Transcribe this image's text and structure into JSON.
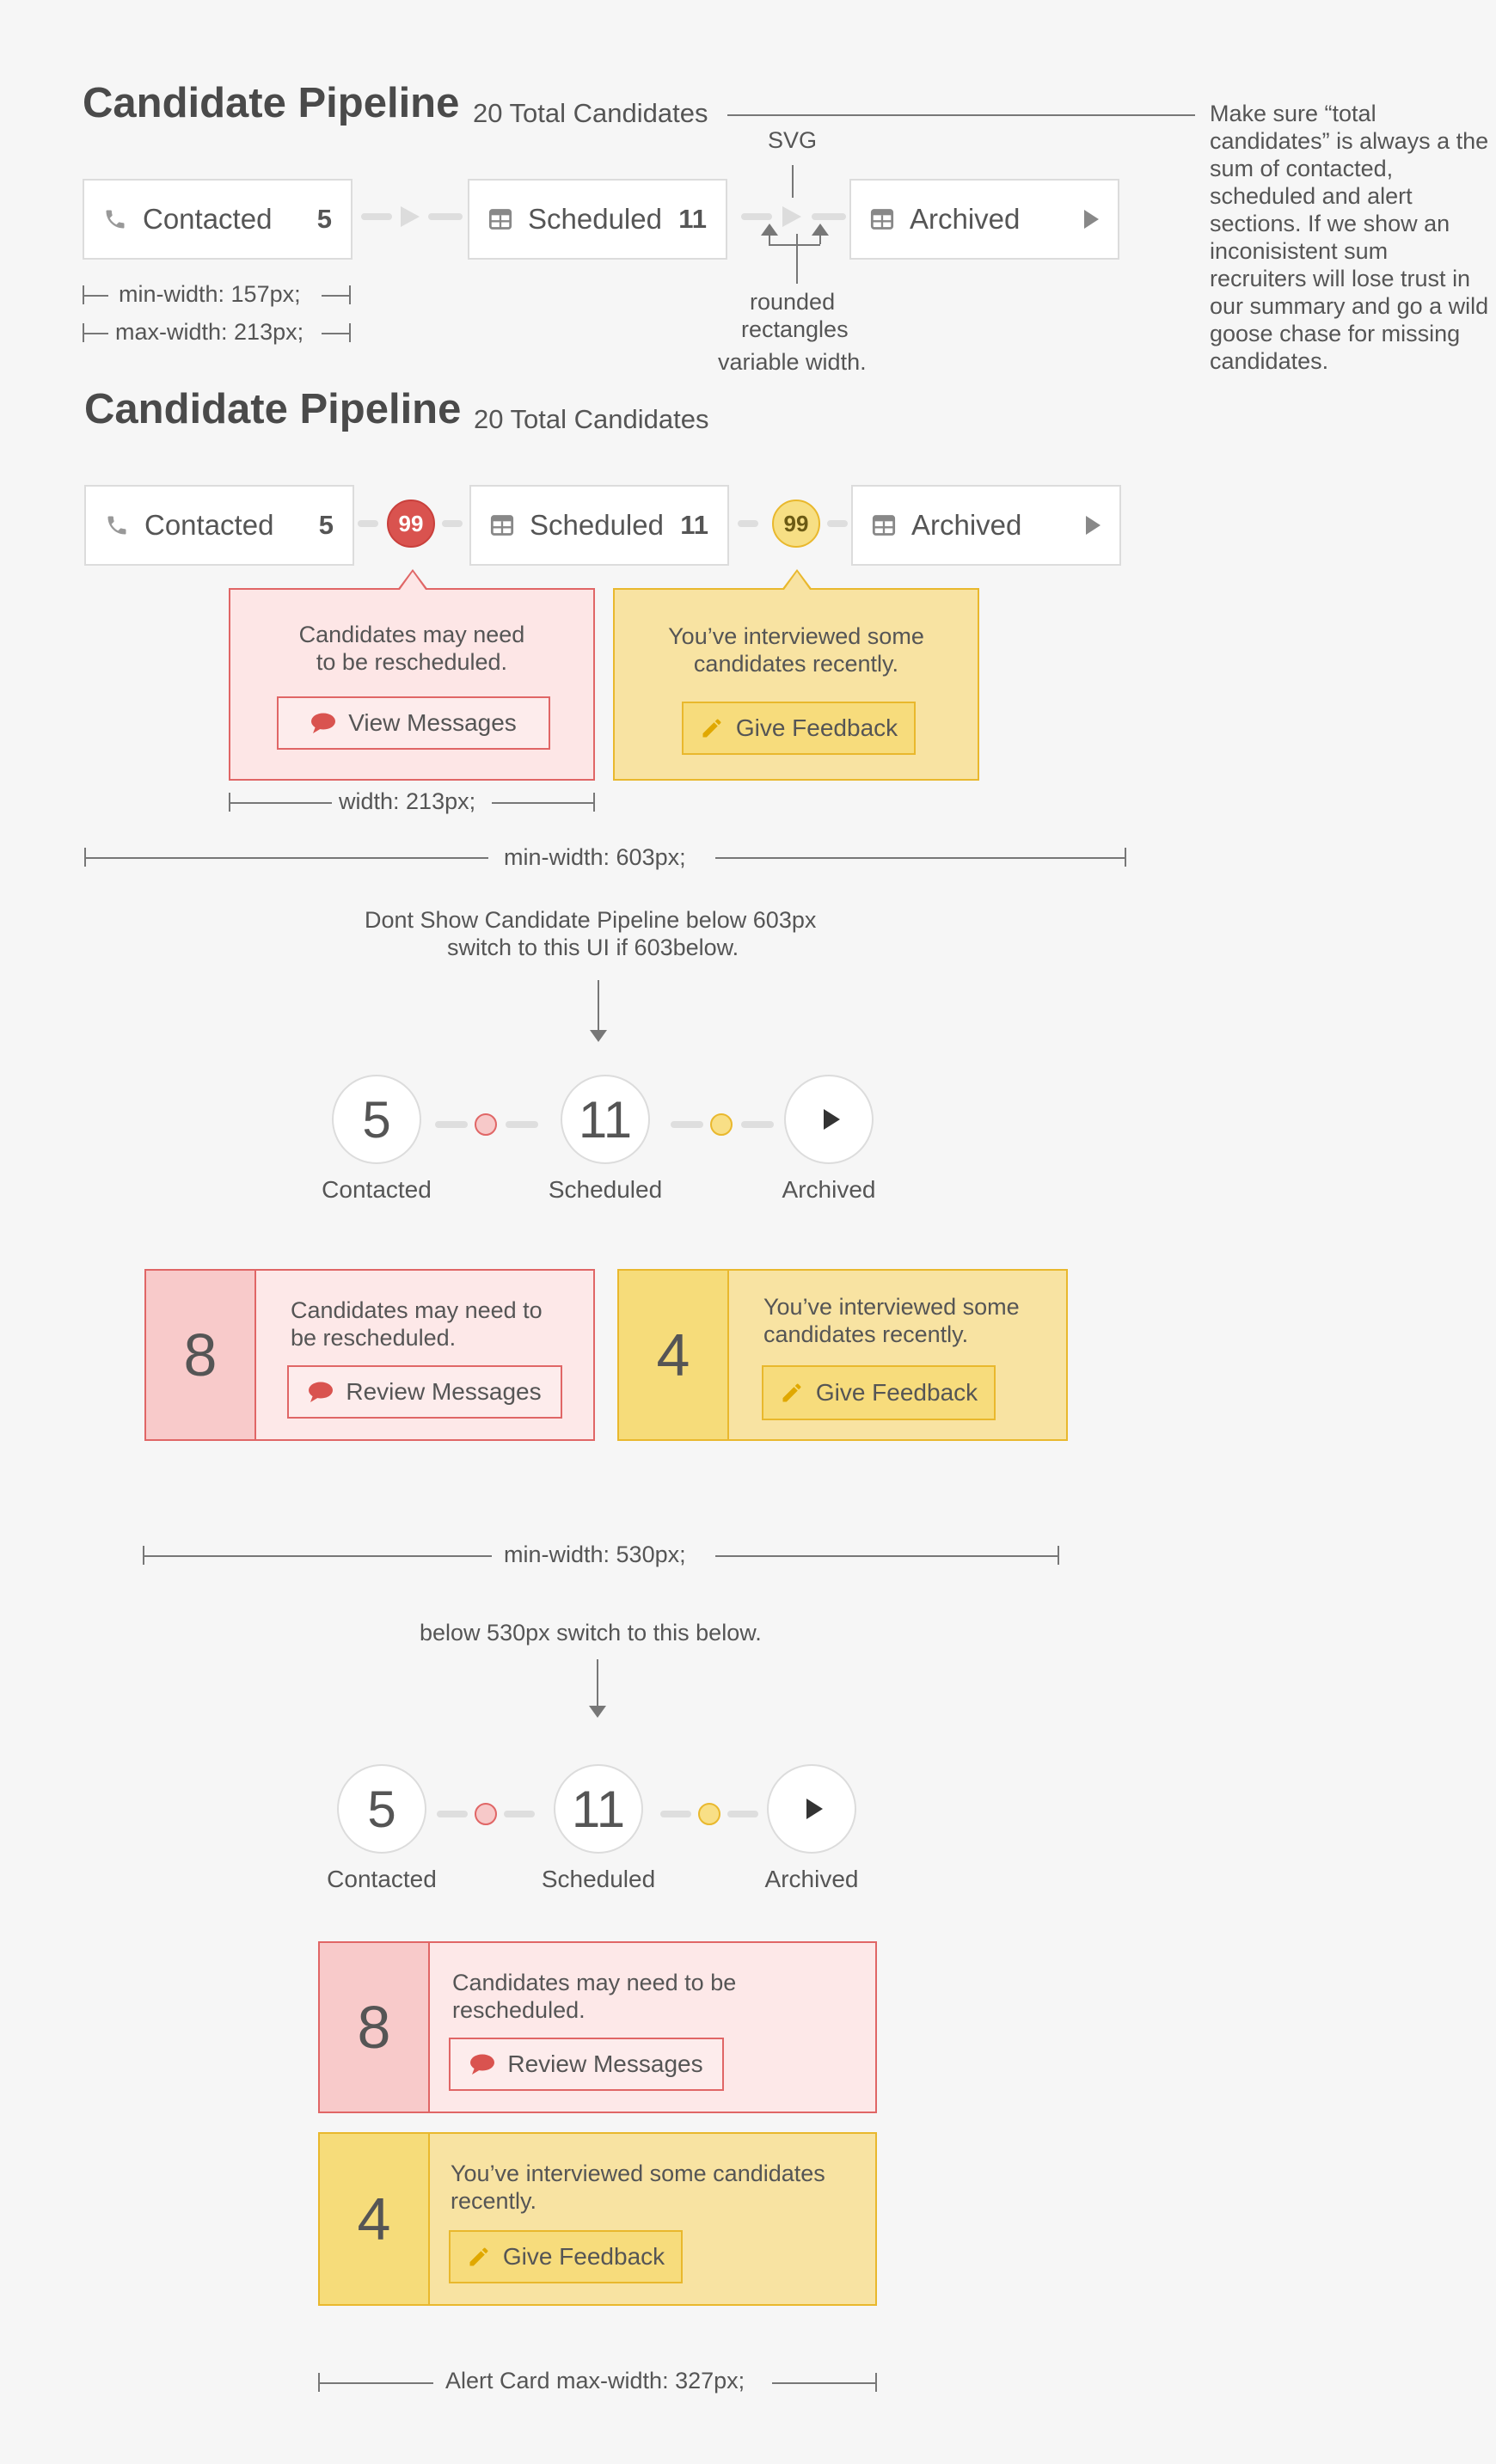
{
  "header": {
    "title": "Candidate Pipeline",
    "total": "20 Total Candidates"
  },
  "annotations": {
    "svg": "SVG",
    "rounded": "rounded",
    "rectangles": "rectangles",
    "variable_width": "variable width.",
    "min_width_stage": "min-width: 157px;",
    "max_width_stage": "max-width: 213px;",
    "popover_width": "width: 213px;",
    "min_width_pipeline": "min-width: 603px;",
    "dont_show_line1": "Dont Show Candidate Pipeline below 603px",
    "dont_show_line2": "switch to this UI if 603below.",
    "min_width_compact": "min-width: 530px;",
    "below_530": "below 530px switch to this below.",
    "alert_max_width": "Alert Card max-width: 327px;",
    "side_note": "Make sure “total candidates” is always a the sum of contacted, scheduled and alert sections. If we show an inconisistent sum recruiters will lose trust in our summary and go a wild goose chase for missing candidates."
  },
  "stages": [
    {
      "label": "Contacted",
      "count": "5",
      "icon": "phone-icon"
    },
    {
      "label": "Scheduled",
      "count": "11",
      "icon": "calendar-icon"
    },
    {
      "label": "Archived",
      "count": "",
      "icon": "calendar-icon"
    }
  ],
  "badges": {
    "red": "99",
    "yellow": "99"
  },
  "popovers": {
    "red": {
      "message_line1": "Candidates may need",
      "message_line2": "to be rescheduled.",
      "button": "View Messages"
    },
    "yellow": {
      "message_line1": "You’ve interviewed some",
      "message_line2": "candidates recently.",
      "button": "Give Feedback"
    }
  },
  "compact": {
    "contacted": {
      "count": "5",
      "label": "Contacted"
    },
    "scheduled": {
      "count": "11",
      "label": "Scheduled"
    },
    "archived": {
      "label": "Archived"
    }
  },
  "alerts_wide": {
    "red": {
      "number": "8",
      "line1": "Candidates may need to",
      "line2": "be rescheduled.",
      "button": "Review Messages"
    },
    "yellow": {
      "number": "4",
      "line1": "You’ve interviewed some",
      "line2": "candidates recently.",
      "button": "Give Feedback"
    }
  },
  "alerts_narrow": {
    "red": {
      "number": "8",
      "line1": "Candidates may need to be",
      "line2": "rescheduled.",
      "button": "Review Messages"
    },
    "yellow": {
      "number": "4",
      "line1": "You’ve interviewed some candidates",
      "line2": "recently.",
      "button": "Give Feedback"
    }
  },
  "colors": {
    "alert_red": "#e06666",
    "alert_red_fill": "#fde6e6",
    "alert_yellow": "#e9b82d",
    "alert_yellow_fill": "#f8e3a2"
  }
}
